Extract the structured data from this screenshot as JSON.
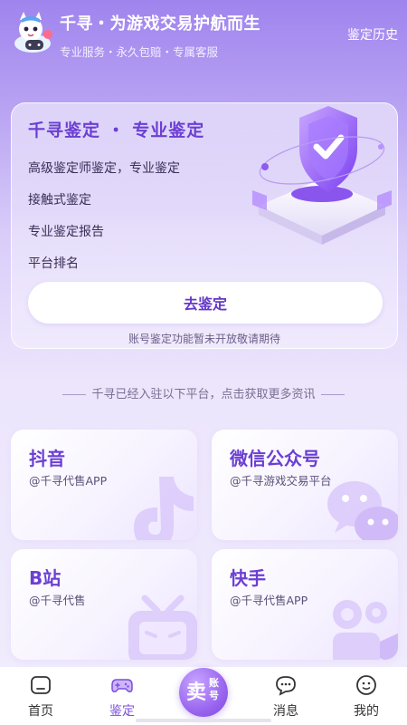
{
  "header": {
    "title": "千寻・为游戏交易护航而生",
    "subtitle": "专业服务・永久包赔・专属客服",
    "history_link": "鉴定历史"
  },
  "appraisal_card": {
    "title": "千寻鉴定 ・ 专业鉴定",
    "features": [
      "高级鉴定师鉴定，专业鉴定",
      "接触式鉴定",
      "专业鉴定报告",
      "平台排名"
    ],
    "button_label": "去鉴定",
    "note": "账号鉴定功能暂未开放敬请期待"
  },
  "platform_intro": "千寻已经入驻以下平台，点击获取更多资讯",
  "platforms": [
    {
      "name": "抖音",
      "handle": "@千寻代售APP",
      "icon": "douyin-icon"
    },
    {
      "name": "微信公众号",
      "handle": "@千寻游戏交易平台",
      "icon": "wechat-icon"
    },
    {
      "name": "B站",
      "handle": "@千寻代售",
      "icon": "bilibili-icon"
    },
    {
      "name": "快手",
      "handle": "@千寻代售APP",
      "icon": "kuaishou-icon"
    }
  ],
  "nav": {
    "items": [
      {
        "label": "首页",
        "icon": "home-icon",
        "active": false
      },
      {
        "label": "鉴定",
        "icon": "gamepad-icon",
        "active": true
      },
      {
        "label": "消息",
        "icon": "message-icon",
        "active": false
      },
      {
        "label": "我的",
        "icon": "profile-icon",
        "active": false
      }
    ],
    "sell": {
      "big": "卖",
      "small": "账号"
    }
  },
  "colors": {
    "accent": "#6b3fd3",
    "nav_active": "#7a4ee0",
    "background_top": "#9f84ee"
  }
}
